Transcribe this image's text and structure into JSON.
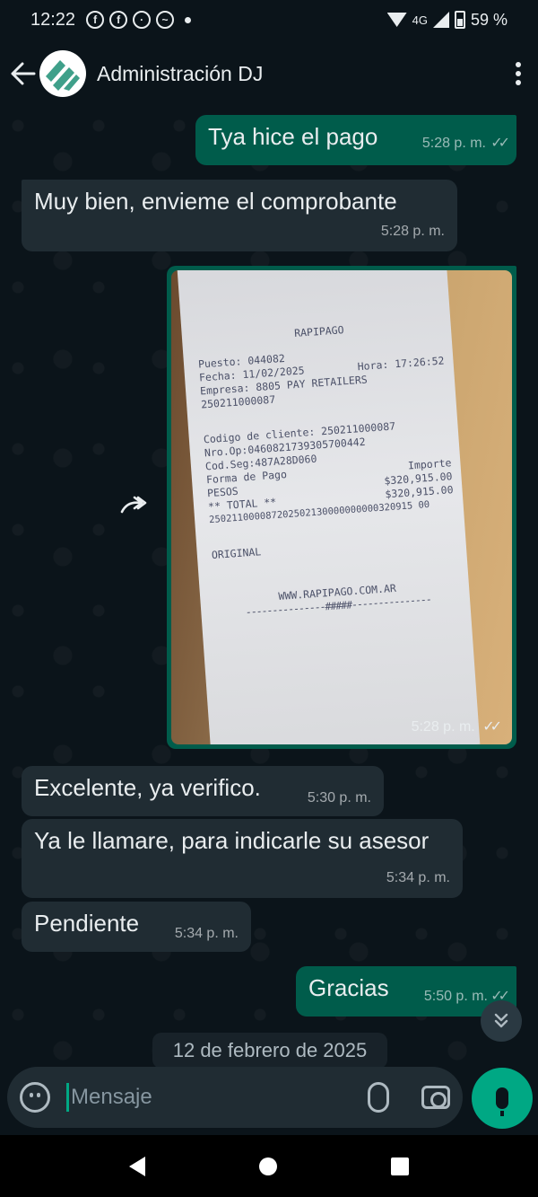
{
  "status_bar": {
    "time": "12:22",
    "notification_icons": [
      "facebook-icon",
      "facebook-icon",
      "messenger-icon",
      "mask-icon",
      "dot"
    ],
    "network": "4G",
    "battery": "59 %"
  },
  "header": {
    "contact_name": "Administración DJ"
  },
  "messages": [
    {
      "direction": "out",
      "text": "Tya hice el pago",
      "time": "5:28 p. m.",
      "read": true
    },
    {
      "direction": "in",
      "text": "Muy bien, envieme el comprobante",
      "time": "5:28 p. m."
    },
    {
      "direction": "out",
      "type": "image",
      "time": "5:28 p. m.",
      "read": true
    },
    {
      "direction": "in",
      "text": "Excelente, ya verifico.",
      "time": "5:30 p. m."
    },
    {
      "direction": "in",
      "text": "Ya le llamare, para indicarle su asesor",
      "time": "5:34 p. m."
    },
    {
      "direction": "in",
      "text": "Pendiente",
      "time": "5:34 p. m."
    },
    {
      "direction": "out",
      "text": "Gracias",
      "time": "5:50 p. m.",
      "read": true
    }
  ],
  "receipt": {
    "brand": "RAPIPAGO",
    "puesto": "Puesto: 044082",
    "fecha": "Fecha: 11/02/2025",
    "hora": "Hora: 17:26:52",
    "empresa": "Empresa: 8805 PAY RETAILERS",
    "empresa_code": "250211000087",
    "codigo_cliente": "Codigo de cliente: 250211000087",
    "nro_op": "Nro.Op:0460821739305700442",
    "cod_seg": "Cod.Seg:487A28D060",
    "forma_pago": "Forma de Pago",
    "importe": "Importe",
    "pesos": "PESOS",
    "pesos_amount": "$320,915.00",
    "total": "** TOTAL **",
    "total_amount": "$320,915.00",
    "barcode_number": "250211000087202502130000000000320915 00",
    "original": "ORIGINAL",
    "website": "WWW.RAPIPAGO.COM.AR",
    "footer": "---------------#####---------------"
  },
  "date_chip": "12 de febrero de 2025",
  "input": {
    "placeholder": "Mensaje"
  }
}
